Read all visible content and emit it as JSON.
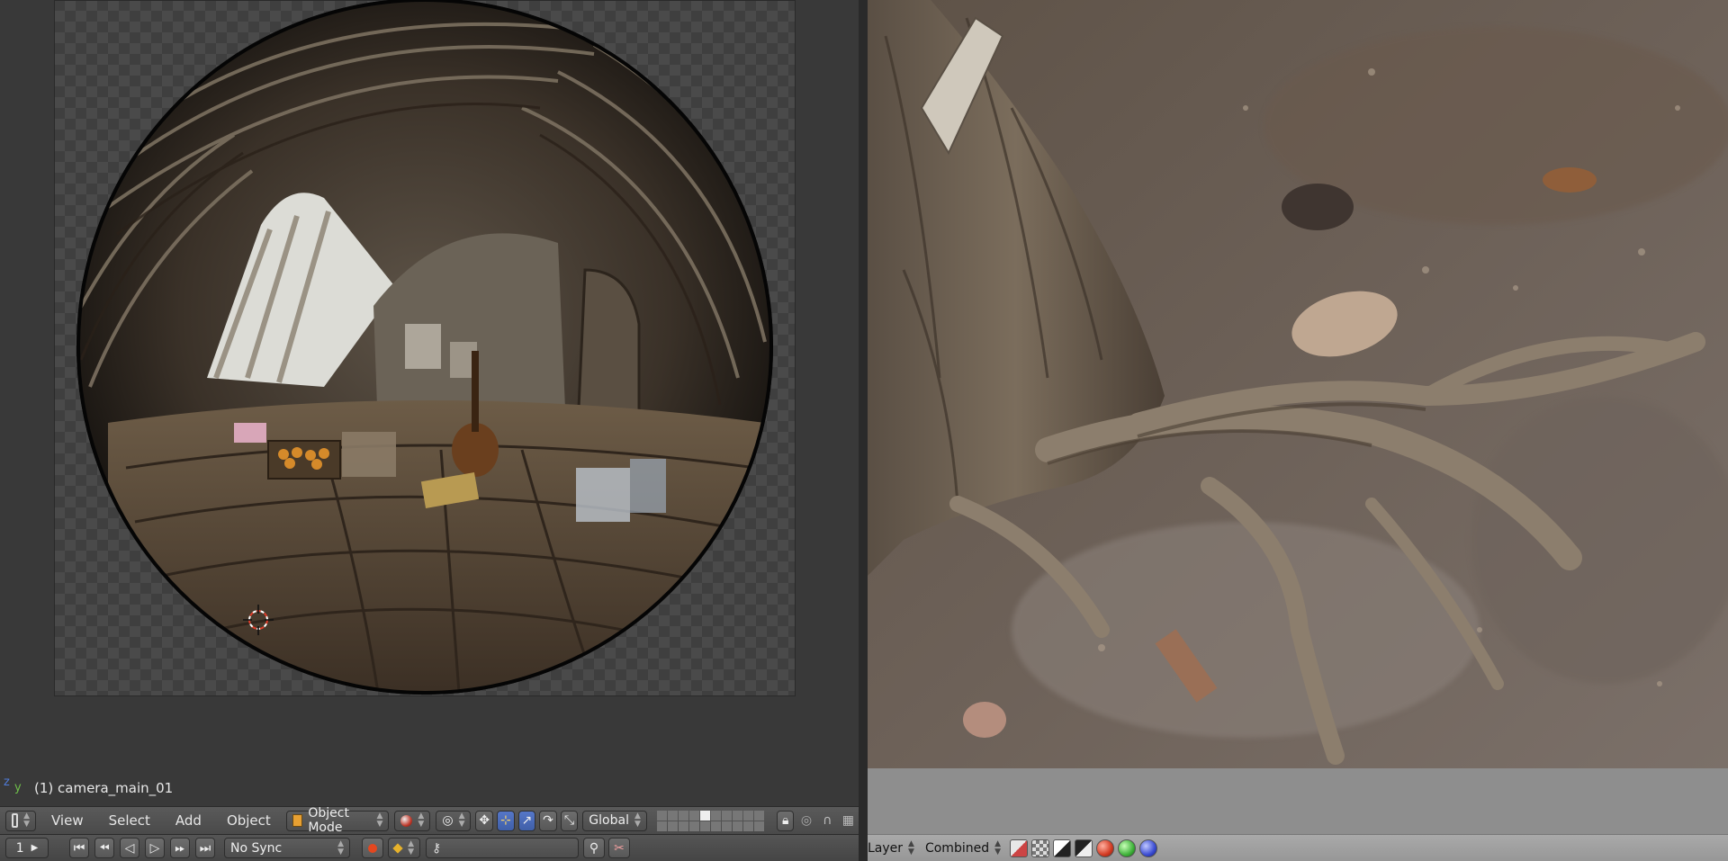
{
  "viewport": {
    "object_label": "(1) camera_main_01",
    "axis_z": "z",
    "axis_y": "y"
  },
  "header1": {
    "menus": [
      "View",
      "Select",
      "Add",
      "Object"
    ],
    "mode": "Object Mode",
    "orientation": "Global"
  },
  "header2": {
    "frame": "1",
    "sync": "No Sync"
  },
  "image_editor": {
    "layer": "Layer",
    "pass": "Combined"
  },
  "colors": {
    "selected_button": "#4a6bbd",
    "record": "#e3471f",
    "keyframe": "#e7b22b"
  }
}
